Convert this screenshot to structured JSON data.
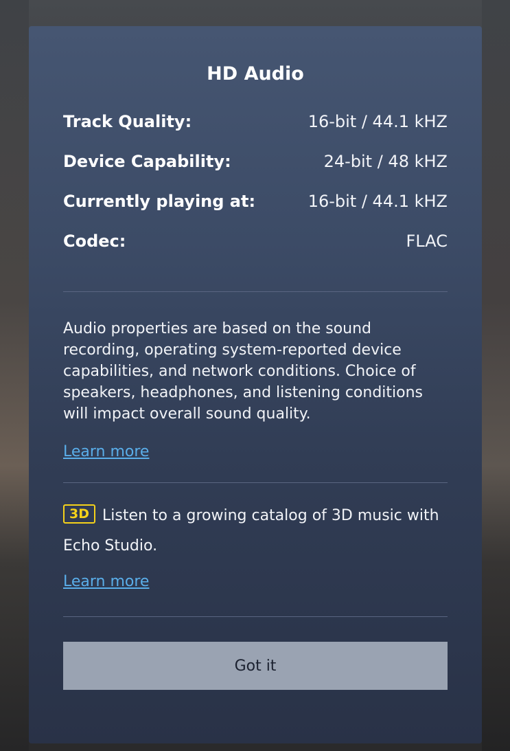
{
  "dialog": {
    "title": "HD Audio",
    "specs": [
      {
        "label": "Track Quality:",
        "value": "16-bit / 44.1 kHZ"
      },
      {
        "label": "Device Capability:",
        "value": "24-bit / 48 kHZ"
      },
      {
        "label": "Currently playing at:",
        "value": "16-bit / 44.1 kHZ"
      },
      {
        "label": "Codec:",
        "value": "FLAC"
      }
    ],
    "description": "Audio properties are based on the sound recording, operating system-reported device capabilities, and network conditions. Choice of speakers, headphones, and listening conditions will impact overall sound quality.",
    "learn_more_1": "Learn more",
    "promo": {
      "badge": "3D",
      "text": "Listen to a growing catalog of 3D music with Echo Studio."
    },
    "learn_more_2": "Learn more",
    "button_label": "Got it"
  },
  "colors": {
    "accent_link": "#5aaeea",
    "badge_yellow": "#f5d21a",
    "button_bg": "#9aa3b2"
  }
}
